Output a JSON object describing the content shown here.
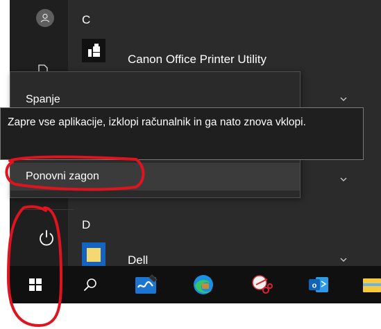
{
  "start_menu": {
    "sections": [
      {
        "letter": "C",
        "apps": [
          {
            "name": "Canon Office Printer Utility",
            "icon": "printer-utility-icon"
          }
        ]
      },
      {
        "letter": "D",
        "apps": [
          {
            "name": "Dell",
            "icon": "folder-icon"
          }
        ]
      }
    ],
    "rail": {
      "user_icon": "user-icon",
      "documents_icon": "document-icon",
      "power_icon": "power-icon"
    }
  },
  "power_menu": {
    "items": [
      {
        "label": "Spanje"
      },
      {
        "label": "Ponovni zagon"
      }
    ]
  },
  "tooltip": {
    "text": "Zapre vse aplikacije, izklopi računalnik in ga nato znova vklopi."
  },
  "taskbar": {
    "items": [
      "windows-start-icon",
      "search-icon",
      "whiteboard-icon",
      "edge-browser-icon",
      "snipping-tool-icon",
      "outlook-icon",
      "file-explorer-icon"
    ]
  },
  "colors": {
    "menu_background": "#2b2b2b",
    "rail_background": "#1f1f1f",
    "taskbar_background": "#101010",
    "annotation_red": "#e0141e"
  }
}
